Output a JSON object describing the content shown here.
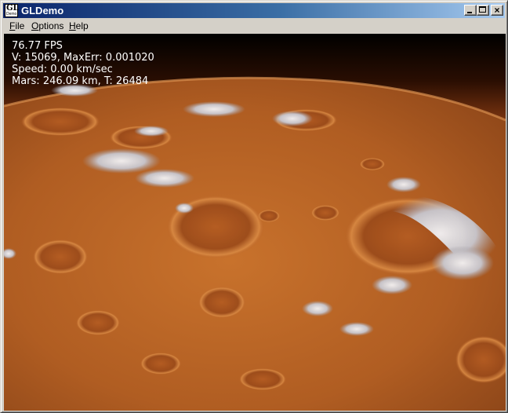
{
  "window": {
    "title": "GLDemo",
    "icon_big": "GL",
    "icon_small": "Demo",
    "minimize": "minimize",
    "maximize": "maximize",
    "close": "×"
  },
  "menu": {
    "file": {
      "accel": "F",
      "rest": "ile"
    },
    "options": {
      "accel": "O",
      "rest": "ptions"
    },
    "help": {
      "accel": "H",
      "rest": "elp"
    }
  },
  "hud": {
    "fps": "76.77 FPS",
    "vertices": "V: 15069, MaxErr: 0.001020",
    "speed": "Speed: 0.00 km/sec",
    "altitude": "Mars: 246.09 km, T: 26484"
  },
  "colors": {
    "title_start": "#0a246a",
    "title_end": "#a6caf0",
    "terrain": "#c06a28",
    "space": "#000000"
  }
}
